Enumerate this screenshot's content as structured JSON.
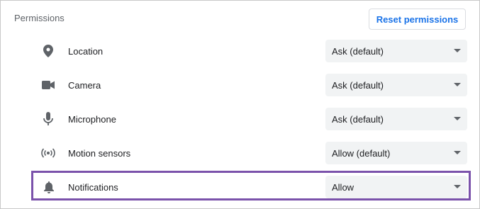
{
  "section": {
    "title": "Permissions",
    "reset_button_label": "Reset permissions"
  },
  "permissions": [
    {
      "icon": "location-pin-icon",
      "label": "Location",
      "value": "Ask (default)"
    },
    {
      "icon": "camera-icon",
      "label": "Camera",
      "value": "Ask (default)"
    },
    {
      "icon": "microphone-icon",
      "label": "Microphone",
      "value": "Ask (default)"
    },
    {
      "icon": "motion-sensors-icon",
      "label": "Motion sensors",
      "value": "Allow (default)"
    },
    {
      "icon": "bell-icon",
      "label": "Notifications",
      "value": "Allow",
      "highlighted": true
    }
  ],
  "colors": {
    "accent": "#1a73e8",
    "highlight_border": "#7b52ab",
    "select_background": "#f1f3f4",
    "icon": "#5f6368"
  }
}
